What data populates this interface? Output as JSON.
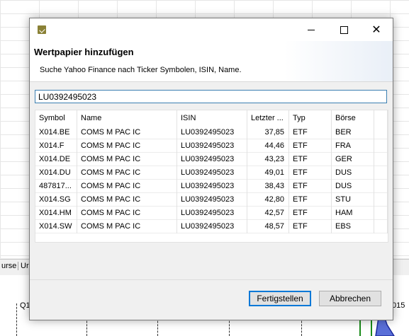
{
  "background": {
    "tabs": [
      "urse",
      "Ur"
    ],
    "chart_labels": [
      "Q1",
      "015"
    ]
  },
  "dialog": {
    "title": "Wertpapier hinzufügen",
    "description": "Suche Yahoo Finance nach Ticker Symbolen, ISIN, Name.",
    "search": {
      "value": "LU0392495023"
    },
    "table": {
      "columns": [
        "Symbol",
        "Name",
        "ISIN",
        "Letzter ...",
        "Typ",
        "Börse"
      ],
      "rows": [
        [
          "X014.BE",
          "COMS M PAC IC",
          "LU0392495023",
          "37,85",
          "ETF",
          "BER"
        ],
        [
          "X014.F",
          "COMS M PAC IC",
          "LU0392495023",
          "44,46",
          "ETF",
          "FRA"
        ],
        [
          "X014.DE",
          "COMS M PAC IC",
          "LU0392495023",
          "43,23",
          "ETF",
          "GER"
        ],
        [
          "X014.DU",
          "COMS M PAC IC",
          "LU0392495023",
          "49,01",
          "ETF",
          "DUS"
        ],
        [
          "487817...",
          "COMS M PAC IC",
          "LU0392495023",
          "38,43",
          "ETF",
          "DUS"
        ],
        [
          "X014.SG",
          "COMS M PAC IC",
          "LU0392495023",
          "42,80",
          "ETF",
          "STU"
        ],
        [
          "X014.HM",
          "COMS M PAC IC",
          "LU0392495023",
          "42,57",
          "ETF",
          "HAM"
        ],
        [
          "X014.SW",
          "COMS M PAC IC",
          "LU0392495023",
          "48,57",
          "ETF",
          "EBS"
        ]
      ]
    },
    "buttons": {
      "finish": "Fertigstellen",
      "cancel": "Abbrechen"
    },
    "window_controls": {
      "minimize_icon": "minimize-icon",
      "maximize_icon": "maximize-icon",
      "close_icon": "close-icon",
      "close_glyph": "✕"
    }
  }
}
